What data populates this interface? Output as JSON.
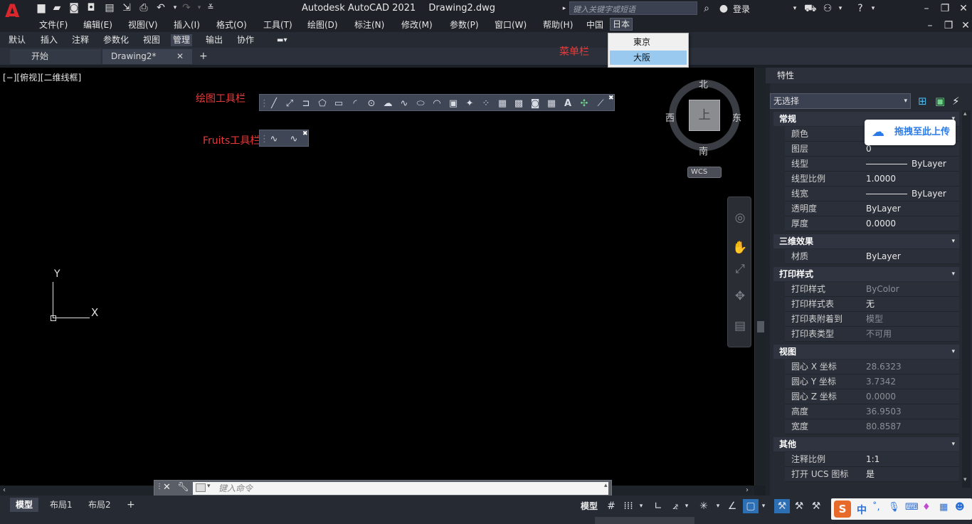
{
  "app": {
    "title": "Autodesk AutoCAD 2021",
    "document": "Drawing2.dwg",
    "logo": "A"
  },
  "search": {
    "placeholder": "键入关键字或短语"
  },
  "account": {
    "login": "登录"
  },
  "menus": [
    "文件(F)",
    "编辑(E)",
    "视图(V)",
    "插入(I)",
    "格式(O)",
    "工具(T)",
    "绘图(D)",
    "标注(N)",
    "修改(M)",
    "参数(P)",
    "窗口(W)",
    "帮助(H)",
    "中国",
    "日本"
  ],
  "dropdown": {
    "items": [
      "東京",
      "大阪"
    ],
    "highlighted": "大阪"
  },
  "ribbon_tabs": [
    "默认",
    "插入",
    "注释",
    "参数化",
    "视图",
    "管理",
    "输出",
    "协作"
  ],
  "file_tabs": {
    "start": "开始",
    "doc": "Drawing2*",
    "add": "+"
  },
  "annotations": {
    "menubar": "菜单栏",
    "draw_toolbar": "绘图工具栏",
    "fruits_toolbar": "Fruits工具栏"
  },
  "viewport": {
    "label": "[−][俯视][二维线框]"
  },
  "viewcube": {
    "north": "北",
    "south": "南",
    "east": "东",
    "west": "西",
    "face": "上",
    "wcs": "WCS"
  },
  "ucs": {
    "x": "X",
    "y": "Y"
  },
  "command": {
    "placeholder": "键入命令"
  },
  "layout_tabs": [
    "模型",
    "布局1",
    "布局2"
  ],
  "status": {
    "model": "模型"
  },
  "properties": {
    "title": "特性",
    "selection": "无选择",
    "sections": [
      {
        "name": "常规",
        "rows": [
          [
            "颜色",
            "",
            false
          ],
          [
            "图层",
            "0",
            false
          ],
          [
            "线型",
            "ByLayer",
            false
          ],
          [
            "线型比例",
            "1.0000",
            false
          ],
          [
            "线宽",
            "ByLayer",
            false
          ],
          [
            "透明度",
            "ByLayer",
            false
          ],
          [
            "厚度",
            "0.0000",
            false
          ]
        ]
      },
      {
        "name": "三维效果",
        "rows": [
          [
            "材质",
            "ByLayer",
            false
          ]
        ]
      },
      {
        "name": "打印样式",
        "rows": [
          [
            "打印样式",
            "ByColor",
            true
          ],
          [
            "打印样式表",
            "无",
            false
          ],
          [
            "打印表附着到",
            "模型",
            true
          ],
          [
            "打印表类型",
            "不可用",
            true
          ]
        ]
      },
      {
        "name": "视图",
        "rows": [
          [
            "圆心 X 坐标",
            "28.6323",
            true
          ],
          [
            "圆心 Y 坐标",
            "3.7342",
            true
          ],
          [
            "圆心 Z 坐标",
            "0.0000",
            true
          ],
          [
            "高度",
            "36.9503",
            true
          ],
          [
            "宽度",
            "80.8587",
            true
          ]
        ]
      },
      {
        "name": "其他",
        "rows": [
          [
            "注释比例",
            "1:1",
            false
          ],
          [
            "打开 UCS 图标",
            "是",
            false
          ]
        ]
      }
    ]
  },
  "upload": {
    "label": "拖拽至此上传"
  },
  "ime": {
    "mode": "中"
  },
  "colors": {
    "accent": "#d8282d",
    "annotation": "#e83a3a",
    "highlight": "#99c9ef"
  }
}
